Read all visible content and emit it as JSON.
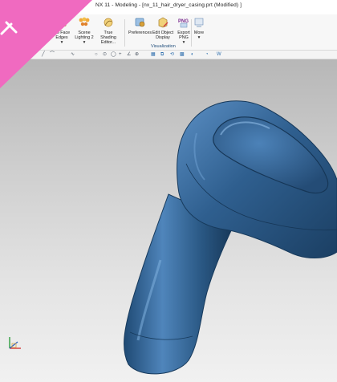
{
  "window": {
    "title": "NX 11 - Modeling - [nx_11_hair_dryer_casing.prt (Modified) ]"
  },
  "ribbon": {
    "buttons": [
      {
        "label": "No Face Edges",
        "dropdown": "▾",
        "icon": "no-face-edges-icon"
      },
      {
        "label": "Scene Lighting 2",
        "dropdown": "▾",
        "icon": "scene-lighting-icon"
      },
      {
        "label": "True Shading Editor...",
        "icon": "true-shading-icon"
      },
      {
        "label": "Preferences",
        "icon": "preferences-icon"
      },
      {
        "label": "Edit Object Display",
        "icon": "edit-object-display-icon"
      },
      {
        "label": "Export PNG",
        "dropdown": "▾",
        "icon": "png-icon",
        "png_text": "PNG"
      },
      {
        "label": "More",
        "dropdown": "▾",
        "icon": "more-icon"
      }
    ],
    "group_label": "Visualization"
  },
  "toolbar": {
    "items": [
      "✢",
      "╱",
      "⌒",
      "∿",
      "○",
      "⊙",
      "◯",
      "+",
      "∠",
      "⊕",
      "▦",
      "⧉",
      "⟲",
      "▩",
      "◐",
      "◔",
      "W"
    ]
  },
  "colors": {
    "accent": "#f06ac0",
    "model": "#2f5f8f"
  }
}
